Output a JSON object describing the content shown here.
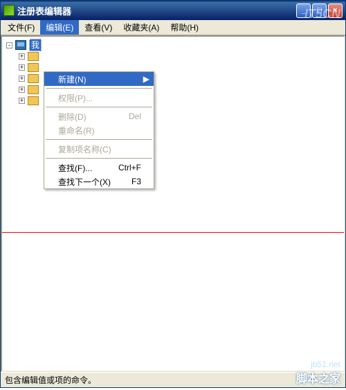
{
  "title": "注册表编辑器",
  "menubar": {
    "file": "文件(F)",
    "edit": "编辑(E)",
    "view": "查看(V)",
    "fav": "收藏夹(A)",
    "help": "帮助(H)"
  },
  "tree": {
    "root": "我"
  },
  "dropdown": {
    "new": "新建(N)",
    "perm": "权限(P)...",
    "del": "删除(D)",
    "del_sc": "Del",
    "rename": "重命名(R)",
    "copykey": "复制项名称(C)",
    "find": "查找(F)...",
    "find_sc": "Ctrl+F",
    "findnext": "查找下一个(X)",
    "findnext_sc": "F3"
  },
  "status": "包含编辑值或项的命令。",
  "watermark": {
    "top": "IT5CN",
    "url": "jb51.net",
    "name": "脚本之家"
  }
}
